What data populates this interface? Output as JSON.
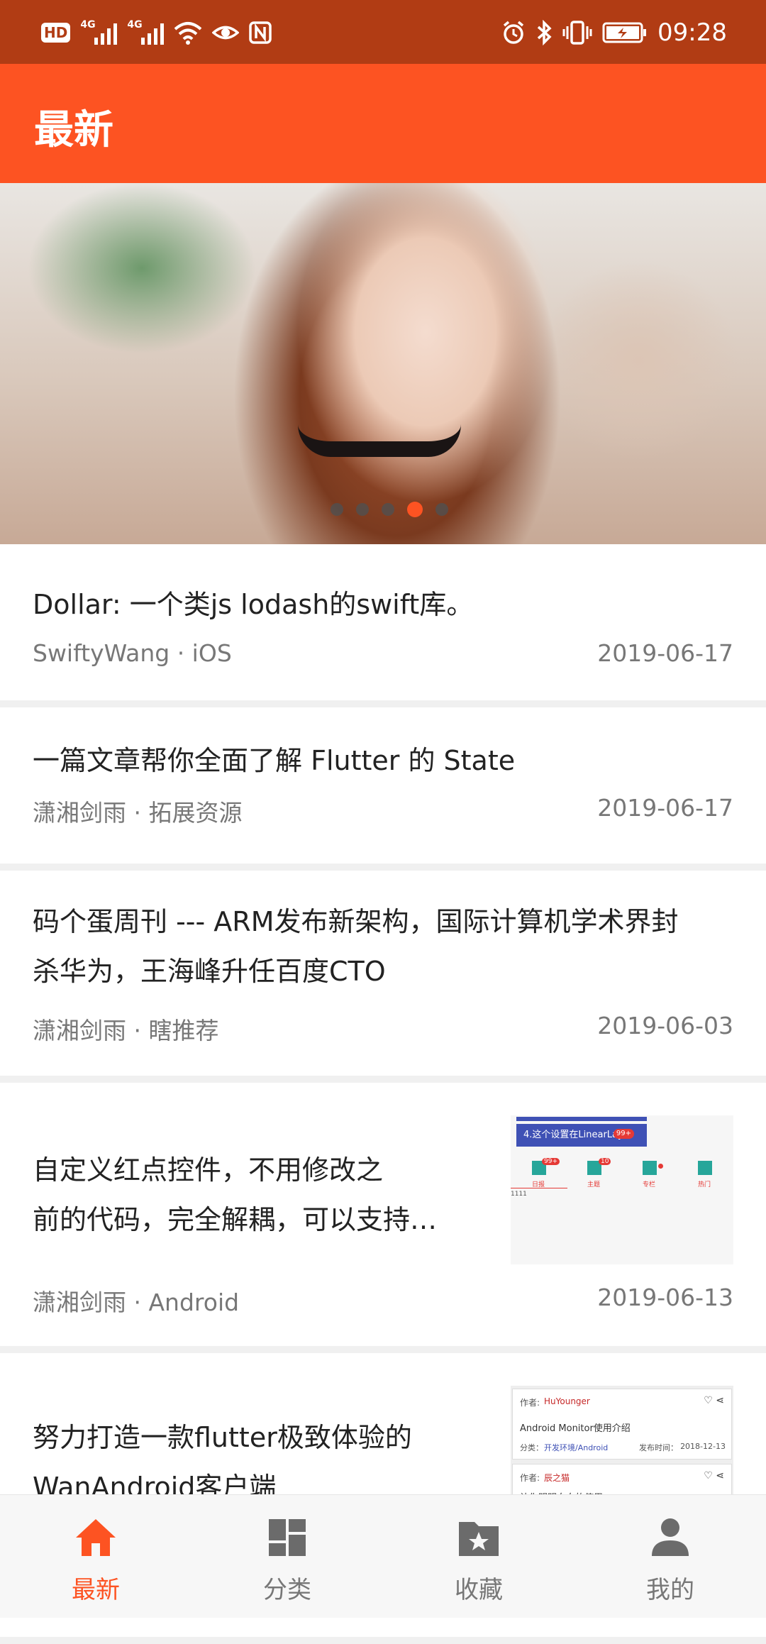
{
  "status_bar": {
    "hd": "HD",
    "network1": "4G",
    "network2": "4G",
    "time": "09:28"
  },
  "app_bar": {
    "title": "最新"
  },
  "banner": {
    "slide_count": 5,
    "active_index": 3
  },
  "articles": [
    {
      "title": "Dollar: 一个类js lodash的swift库。",
      "meta": "SwiftyWang · iOS",
      "date": "2019-06-17"
    },
    {
      "title": "一篇文章帮你全面了解 Flutter 的 State",
      "meta": "潇湘剑雨 · 拓展资源",
      "date": "2019-06-17"
    },
    {
      "title_line1": "码个蛋周刊 --- ARM发布新架构，国际计算机学术界封",
      "title_line2": "杀华为，王海峰升任百度CTO",
      "meta": "潇湘剑雨 · 瞎推荐",
      "date": "2019-06-03"
    },
    {
      "title_line1": "自定义红点控件，不用修改之",
      "title_line2": "前的代码，完全解耦，可以支持…",
      "meta": "潇湘剑雨 · Android",
      "date": "2019-06-13",
      "thumb": {
        "header": "4.这个设置在LinearLay",
        "badge": "99+",
        "items": [
          "日报",
          "主题",
          "专栏",
          "热门"
        ],
        "badges": [
          "99+",
          "10",
          ""
        ],
        "footer": "1111"
      }
    },
    {
      "title_line1": "努力打造一款flutter极致体验的",
      "title_line2": "WanAndroid客户端",
      "thumb": {
        "author_label": "作者:",
        "author1": "HuYounger",
        "title1": "Android Monitor使用介绍",
        "category_label": "分类：",
        "category": "开发环境/Android",
        "publish_label": "发布时间：",
        "publish_date": "2018-12-13",
        "author2": "辰之猫",
        "title2": "让你明明白白的使用"
      }
    }
  ],
  "bottom_nav": [
    {
      "label": "最新",
      "icon": "home-icon",
      "active": true
    },
    {
      "label": "分类",
      "icon": "dashboard-icon",
      "active": false
    },
    {
      "label": "收藏",
      "icon": "folder-star-icon",
      "active": false
    },
    {
      "label": "我的",
      "icon": "person-icon",
      "active": false
    }
  ],
  "colors": {
    "accent": "#fd5322",
    "status_bar": "#b13c14",
    "text": "#222222",
    "meta": "#777777"
  }
}
